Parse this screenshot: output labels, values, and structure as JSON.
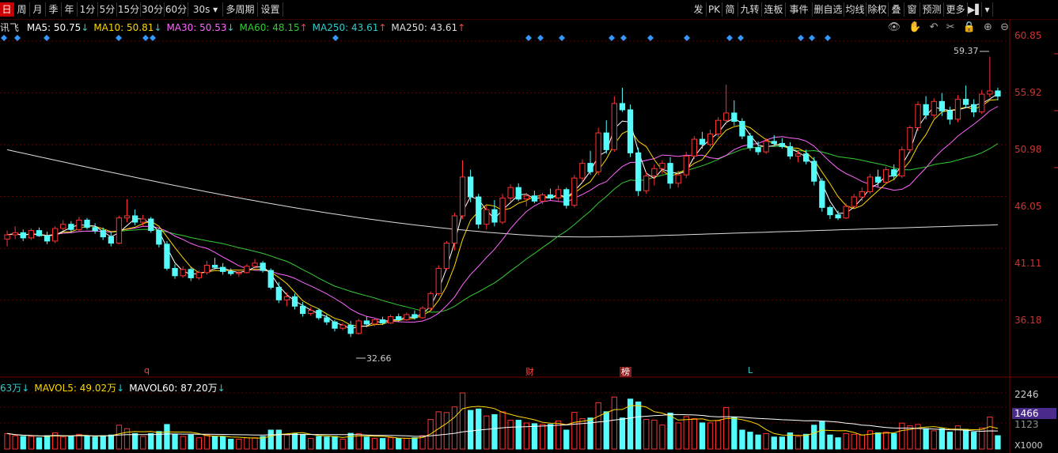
{
  "toolbar": {
    "left": [
      "日",
      "周",
      "月",
      "季",
      "年",
      "1分",
      "5分",
      "15分",
      "30分",
      "60分",
      "30s",
      "多周期",
      "设置"
    ],
    "active_index": 0,
    "right": [
      "发",
      "PK",
      "简",
      "九转",
      "连板",
      "事件",
      "删自选",
      "均线",
      "除权",
      "叠",
      "窗",
      "预测",
      "更多"
    ]
  },
  "legend": {
    "name": "讯飞",
    "ma": [
      {
        "label": "MA5: 50.75",
        "arrow": "↓",
        "color": "#ffffff"
      },
      {
        "label": "MA10: 50.81",
        "arrow": "↓",
        "color": "#ffd800"
      },
      {
        "label": "MA30: 50.53",
        "arrow": "↓",
        "color": "#ff66ff"
      },
      {
        "label": "MA60: 48.15",
        "arrow": "↑",
        "color": "#33cc33"
      },
      {
        "label": "MA250: 43.61",
        "arrow": "↑",
        "color": "#33cccc"
      },
      {
        "label": "MA250: 43.61",
        "arrow": "↑",
        "color": "#dddddd"
      }
    ]
  },
  "vol_legend": {
    "items": [
      {
        "label": "63万",
        "arrow": "↓",
        "color": "#33cccc"
      },
      {
        "label": "MAVOL5: 49.02万",
        "arrow": "↓",
        "color": "#ffd800"
      },
      {
        "label": "MAVOL60: 87.20万",
        "arrow": "↓",
        "color": "#ffffff"
      }
    ]
  },
  "price_axis": [
    "60.85",
    "55.92",
    "50.98",
    "46.05",
    "41.11",
    "36.18"
  ],
  "vol_axis": [
    "2246",
    "1466",
    "1123"
  ],
  "vol_unit": "X1000",
  "annotations": {
    "high": "59.37",
    "low": "32.66"
  },
  "events": [
    {
      "text": "q",
      "color": "#ff4444",
      "box": false
    },
    {
      "text": "财",
      "color": "#ff4444",
      "box": false
    },
    {
      "text": "榜",
      "color": "#ffffff",
      "box": true
    },
    {
      "text": "L",
      "color": "#33cccc",
      "box": false
    }
  ],
  "icons": [
    "eye-icon",
    "hand-icon",
    "undo-icon",
    "scissors-icon",
    "lock-icon",
    "zoom-in-icon",
    "zoom-out-icon"
  ],
  "chart_data": {
    "type": "candlestick",
    "ylim": [
      30.5,
      62.5
    ],
    "candles": [
      [
        42.0,
        42.8,
        41.3,
        42.4
      ],
      [
        42.4,
        43.2,
        42.0,
        42.6
      ],
      [
        42.6,
        42.9,
        41.8,
        42.1
      ],
      [
        42.1,
        43.0,
        41.9,
        42.8
      ],
      [
        42.8,
        43.1,
        42.2,
        42.3
      ],
      [
        42.3,
        42.7,
        41.5,
        41.8
      ],
      [
        41.8,
        43.2,
        41.6,
        43.0
      ],
      [
        43.0,
        43.8,
        42.8,
        43.4
      ],
      [
        43.4,
        43.7,
        42.6,
        42.9
      ],
      [
        42.9,
        44.1,
        42.7,
        43.8
      ],
      [
        43.8,
        44.0,
        42.9,
        43.1
      ],
      [
        43.1,
        43.5,
        42.5,
        42.8
      ],
      [
        42.8,
        43.1,
        41.9,
        42.2
      ],
      [
        42.2,
        42.6,
        41.3,
        41.6
      ],
      [
        41.6,
        44.2,
        41.5,
        44.0
      ],
      [
        44.0,
        45.8,
        43.6,
        44.2
      ],
      [
        44.2,
        44.8,
        43.3,
        43.6
      ],
      [
        43.6,
        44.3,
        43.2,
        43.9
      ],
      [
        43.9,
        44.1,
        42.6,
        42.8
      ],
      [
        42.8,
        43.0,
        41.2,
        41.5
      ],
      [
        41.5,
        41.8,
        39.0,
        39.2
      ],
      [
        39.2,
        39.6,
        38.2,
        38.5
      ],
      [
        38.5,
        39.4,
        38.3,
        39.1
      ],
      [
        39.1,
        39.3,
        38.0,
        38.3
      ],
      [
        38.3,
        39.0,
        38.1,
        38.8
      ],
      [
        38.8,
        39.9,
        38.6,
        39.5
      ],
      [
        39.5,
        40.2,
        39.1,
        39.3
      ],
      [
        39.3,
        39.7,
        38.6,
        38.9
      ],
      [
        38.9,
        39.2,
        38.5,
        38.7
      ],
      [
        38.7,
        39.1,
        38.4,
        38.8
      ],
      [
        38.8,
        39.6,
        38.7,
        39.4
      ],
      [
        39.4,
        40.1,
        39.2,
        39.7
      ],
      [
        39.7,
        39.9,
        38.8,
        39.0
      ],
      [
        39.0,
        39.2,
        37.2,
        37.4
      ],
      [
        37.4,
        37.9,
        35.9,
        36.2
      ],
      [
        36.2,
        36.9,
        35.6,
        36.5
      ],
      [
        36.5,
        36.8,
        35.3,
        35.6
      ],
      [
        35.6,
        36.0,
        34.6,
        34.9
      ],
      [
        34.9,
        35.5,
        34.7,
        35.2
      ],
      [
        35.2,
        35.4,
        34.3,
        34.5
      ],
      [
        34.5,
        34.8,
        33.8,
        34.1
      ],
      [
        34.1,
        34.3,
        33.2,
        33.5
      ],
      [
        33.5,
        34.0,
        33.3,
        33.8
      ],
      [
        33.8,
        34.2,
        32.66,
        33.0
      ],
      [
        33.0,
        34.4,
        32.9,
        34.2
      ],
      [
        34.2,
        34.6,
        33.6,
        33.9
      ],
      [
        33.9,
        34.5,
        33.7,
        34.3
      ],
      [
        34.3,
        34.6,
        33.8,
        34.0
      ],
      [
        34.0,
        34.8,
        33.9,
        34.6
      ],
      [
        34.6,
        34.9,
        34.1,
        34.3
      ],
      [
        34.3,
        35.0,
        34.2,
        34.8
      ],
      [
        34.8,
        35.2,
        34.3,
        34.5
      ],
      [
        34.5,
        35.6,
        34.4,
        35.4
      ],
      [
        35.4,
        37.0,
        35.2,
        36.8
      ],
      [
        36.8,
        39.5,
        36.6,
        39.2
      ],
      [
        39.2,
        41.8,
        39.0,
        41.6
      ],
      [
        41.6,
        44.5,
        40.9,
        44.2
      ],
      [
        44.2,
        49.5,
        43.9,
        47.9
      ],
      [
        47.9,
        48.6,
        45.5,
        46.0
      ],
      [
        46.0,
        46.3,
        43.0,
        43.4
      ],
      [
        43.4,
        45.2,
        42.9,
        44.8
      ],
      [
        44.8,
        45.7,
        43.2,
        43.6
      ],
      [
        43.6,
        46.3,
        43.4,
        45.9
      ],
      [
        45.9,
        47.2,
        45.5,
        46.9
      ],
      [
        46.9,
        47.3,
        45.6,
        45.8
      ],
      [
        45.8,
        46.4,
        45.1,
        46.1
      ],
      [
        46.1,
        46.6,
        45.4,
        45.6
      ],
      [
        45.6,
        46.4,
        45.3,
        46.2
      ],
      [
        46.2,
        46.8,
        45.7,
        45.9
      ],
      [
        45.9,
        47.1,
        45.5,
        46.7
      ],
      [
        46.7,
        46.9,
        44.9,
        45.2
      ],
      [
        45.2,
        48.1,
        45.0,
        47.8
      ],
      [
        47.8,
        49.6,
        47.4,
        49.2
      ],
      [
        49.2,
        50.4,
        48.1,
        48.4
      ],
      [
        48.4,
        52.6,
        48.1,
        52.1
      ],
      [
        52.1,
        53.3,
        50.1,
        50.5
      ],
      [
        50.5,
        55.6,
        50.3,
        54.9
      ],
      [
        54.9,
        56.4,
        54.1,
        54.3
      ],
      [
        54.3,
        54.8,
        49.8,
        50.2
      ],
      [
        50.2,
        50.7,
        46.1,
        46.6
      ],
      [
        46.6,
        48.4,
        46.3,
        48.0
      ],
      [
        48.0,
        49.1,
        47.1,
        48.7
      ],
      [
        48.7,
        49.5,
        48.2,
        49.2
      ],
      [
        49.2,
        49.8,
        46.8,
        47.3
      ],
      [
        47.3,
        48.5,
        46.9,
        48.1
      ],
      [
        48.1,
        50.3,
        47.8,
        49.9
      ],
      [
        49.9,
        51.8,
        49.6,
        51.5
      ],
      [
        51.5,
        52.2,
        50.6,
        51.0
      ],
      [
        51.0,
        52.4,
        50.8,
        52.0
      ],
      [
        52.0,
        53.6,
        51.7,
        53.3
      ],
      [
        53.3,
        56.7,
        52.9,
        54.0
      ],
      [
        54.0,
        55.2,
        52.8,
        53.2
      ],
      [
        53.2,
        53.5,
        51.5,
        51.8
      ],
      [
        51.8,
        52.1,
        50.4,
        50.7
      ],
      [
        50.7,
        51.3,
        50.0,
        50.3
      ],
      [
        50.3,
        51.6,
        50.1,
        51.3
      ],
      [
        51.3,
        51.9,
        50.9,
        51.1
      ],
      [
        51.1,
        51.6,
        50.6,
        50.8
      ],
      [
        50.8,
        51.2,
        49.6,
        49.9
      ],
      [
        49.9,
        50.4,
        49.3,
        50.1
      ],
      [
        50.1,
        50.5,
        49.1,
        49.4
      ],
      [
        49.4,
        49.8,
        47.1,
        47.5
      ],
      [
        47.5,
        47.8,
        44.6,
        45.0
      ],
      [
        45.0,
        45.2,
        43.9,
        44.3
      ],
      [
        44.3,
        44.7,
        43.8,
        44.0
      ],
      [
        44.0,
        45.4,
        43.9,
        45.1
      ],
      [
        45.1,
        46.3,
        44.9,
        46.0
      ],
      [
        46.0,
        46.9,
        45.6,
        46.5
      ],
      [
        46.5,
        48.2,
        46.3,
        47.9
      ],
      [
        47.9,
        48.6,
        47.0,
        47.4
      ],
      [
        47.4,
        48.9,
        47.2,
        48.6
      ],
      [
        48.6,
        49.1,
        47.6,
        48.0
      ],
      [
        48.0,
        50.8,
        47.8,
        50.5
      ],
      [
        50.5,
        52.8,
        50.2,
        52.6
      ],
      [
        52.6,
        55.1,
        52.3,
        54.8
      ],
      [
        54.8,
        55.6,
        53.4,
        53.8
      ],
      [
        53.8,
        55.4,
        53.5,
        55.1
      ],
      [
        55.1,
        55.9,
        53.7,
        54.2
      ],
      [
        54.2,
        54.6,
        52.9,
        53.4
      ],
      [
        53.4,
        55.7,
        53.1,
        55.3
      ],
      [
        55.3,
        56.6,
        54.5,
        54.8
      ],
      [
        54.8,
        55.3,
        53.6,
        54.1
      ],
      [
        54.1,
        56.2,
        53.9,
        55.8
      ],
      [
        55.8,
        59.37,
        55.5,
        56.1
      ],
      [
        56.1,
        56.4,
        55.2,
        55.6
      ]
    ]
  }
}
